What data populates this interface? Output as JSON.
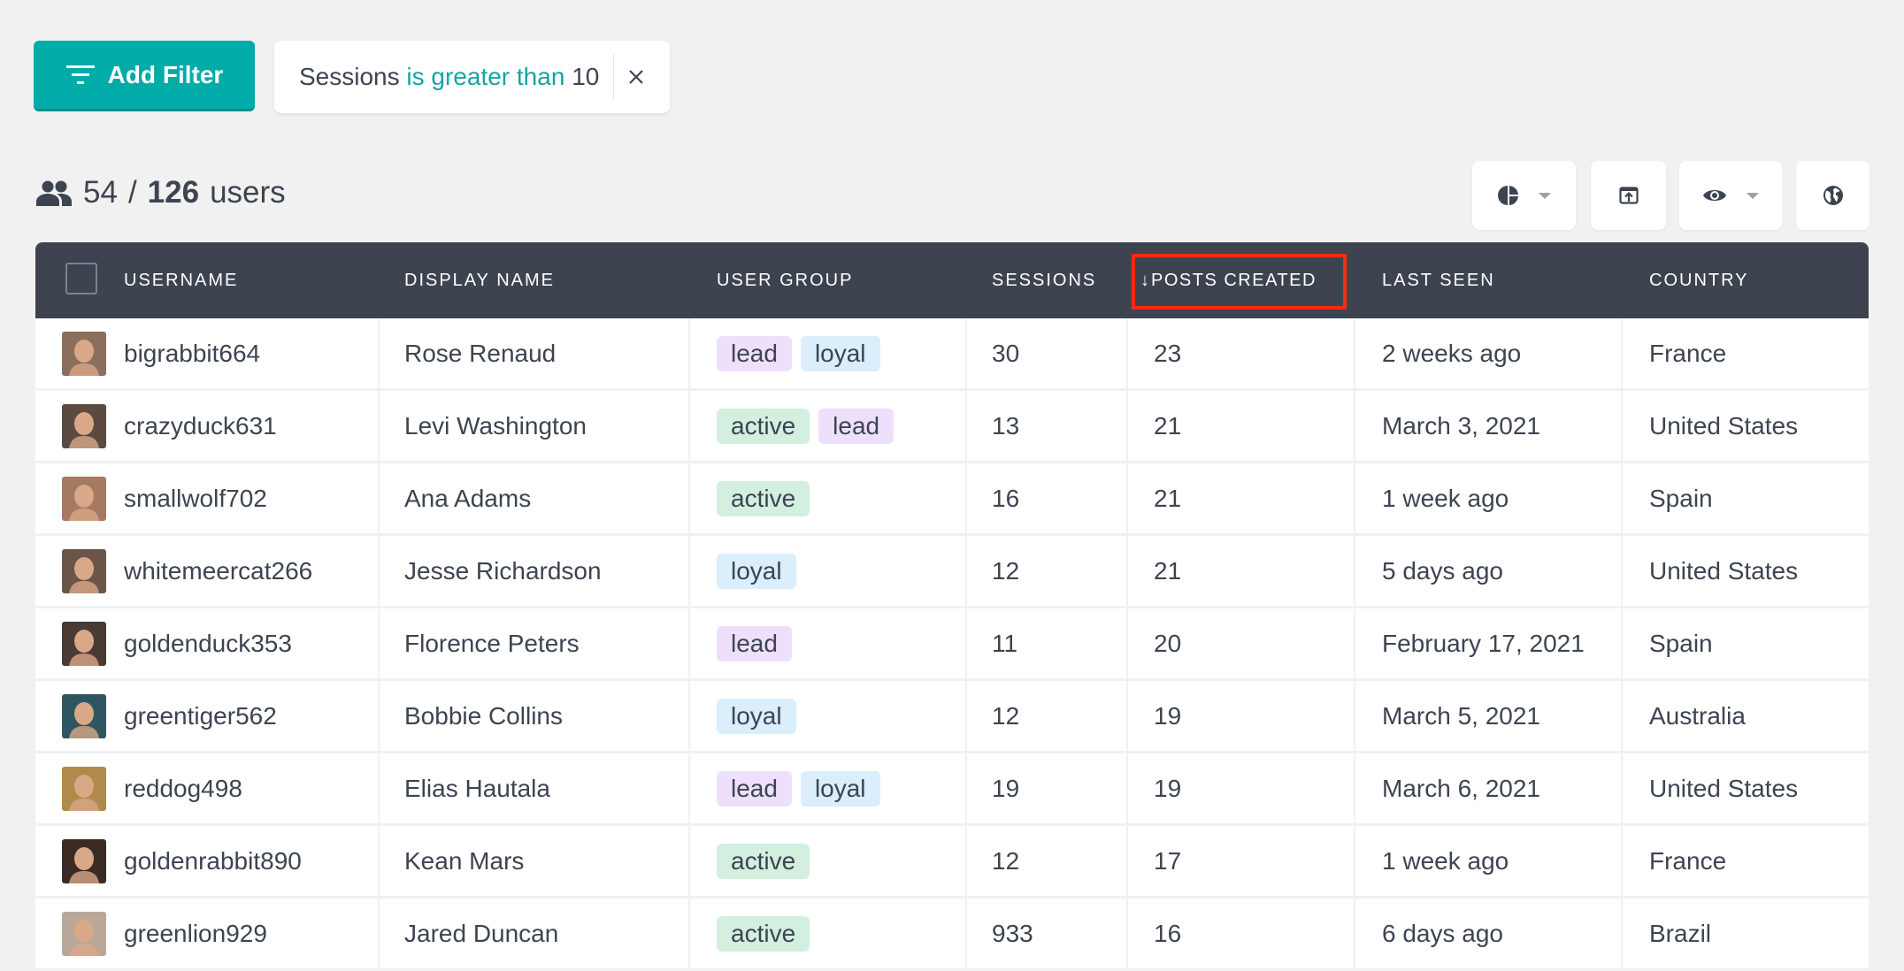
{
  "filter_bar": {
    "add_filter_label": "Add Filter",
    "active_filter": {
      "field": "Sessions",
      "operator": "is greater than",
      "value": "10"
    }
  },
  "summary": {
    "shown": "54",
    "separator": "/",
    "total": "126",
    "unit": "users"
  },
  "toolbar": {
    "buttons": [
      {
        "icon": "pie-chart-icon",
        "has_dropdown": true
      },
      {
        "icon": "export-icon",
        "has_dropdown": false
      },
      {
        "icon": "eye-icon",
        "has_dropdown": true
      },
      {
        "icon": "globe-icon",
        "has_dropdown": false
      }
    ]
  },
  "table": {
    "columns": [
      {
        "key": "username",
        "label": "USERNAME"
      },
      {
        "key": "display_name",
        "label": "DISPLAY NAME"
      },
      {
        "key": "user_group",
        "label": "USER GROUP"
      },
      {
        "key": "sessions",
        "label": "SESSIONS"
      },
      {
        "key": "posts_created",
        "label": "POSTS CREATED",
        "sort": "desc",
        "sort_glyph": "↓"
      },
      {
        "key": "last_seen",
        "label": "LAST SEEN"
      },
      {
        "key": "country",
        "label": "COUNTRY"
      }
    ],
    "rows": [
      {
        "username": "bigrabbit664",
        "display_name": "Rose Renaud",
        "groups": [
          "lead",
          "loyal"
        ],
        "sessions": "30",
        "posts_created": "23",
        "last_seen": "2 weeks ago",
        "country": "France",
        "avatar_color": "#8a6f5c"
      },
      {
        "username": "crazyduck631",
        "display_name": "Levi Washington",
        "groups": [
          "active",
          "lead"
        ],
        "sessions": "13",
        "posts_created": "21",
        "last_seen": "March 3, 2021",
        "country": "United States",
        "avatar_color": "#5b4a3f"
      },
      {
        "username": "smallwolf702",
        "display_name": "Ana Adams",
        "groups": [
          "active"
        ],
        "sessions": "16",
        "posts_created": "21",
        "last_seen": "1 week ago",
        "country": "Spain",
        "avatar_color": "#a57a62"
      },
      {
        "username": "whitemeercat266",
        "display_name": "Jesse Richardson",
        "groups": [
          "loyal"
        ],
        "sessions": "12",
        "posts_created": "21",
        "last_seen": "5 days ago",
        "country": "United States",
        "avatar_color": "#6a5648"
      },
      {
        "username": "goldenduck353",
        "display_name": "Florence Peters",
        "groups": [
          "lead"
        ],
        "sessions": "11",
        "posts_created": "20",
        "last_seen": "February 17, 2021",
        "country": "Spain",
        "avatar_color": "#4a3a34"
      },
      {
        "username": "greentiger562",
        "display_name": "Bobbie Collins",
        "groups": [
          "loyal"
        ],
        "sessions": "12",
        "posts_created": "19",
        "last_seen": "March 5, 2021",
        "country": "Australia",
        "avatar_color": "#2f5560"
      },
      {
        "username": "reddog498",
        "display_name": "Elias Hautala",
        "groups": [
          "lead",
          "loyal"
        ],
        "sessions": "19",
        "posts_created": "19",
        "last_seen": "March 6, 2021",
        "country": "United States",
        "avatar_color": "#b08a4a"
      },
      {
        "username": "goldenrabbit890",
        "display_name": "Kean Mars",
        "groups": [
          "active"
        ],
        "sessions": "12",
        "posts_created": "17",
        "last_seen": "1 week ago",
        "country": "France",
        "avatar_color": "#3a2c24"
      },
      {
        "username": "greenlion929",
        "display_name": "Jared Duncan",
        "groups": [
          "active"
        ],
        "sessions": "933",
        "posts_created": "16",
        "last_seen": "6 days ago",
        "country": "Brazil",
        "avatar_color": "#b9a89a"
      }
    ]
  },
  "tag_colors": {
    "lead": "#eee0fc",
    "loyal": "#daeefb",
    "active": "#d3efdf"
  },
  "colors": {
    "accent": "#00aba8",
    "header_bg": "#3d4450",
    "highlight_box": "#ff2a0f"
  }
}
